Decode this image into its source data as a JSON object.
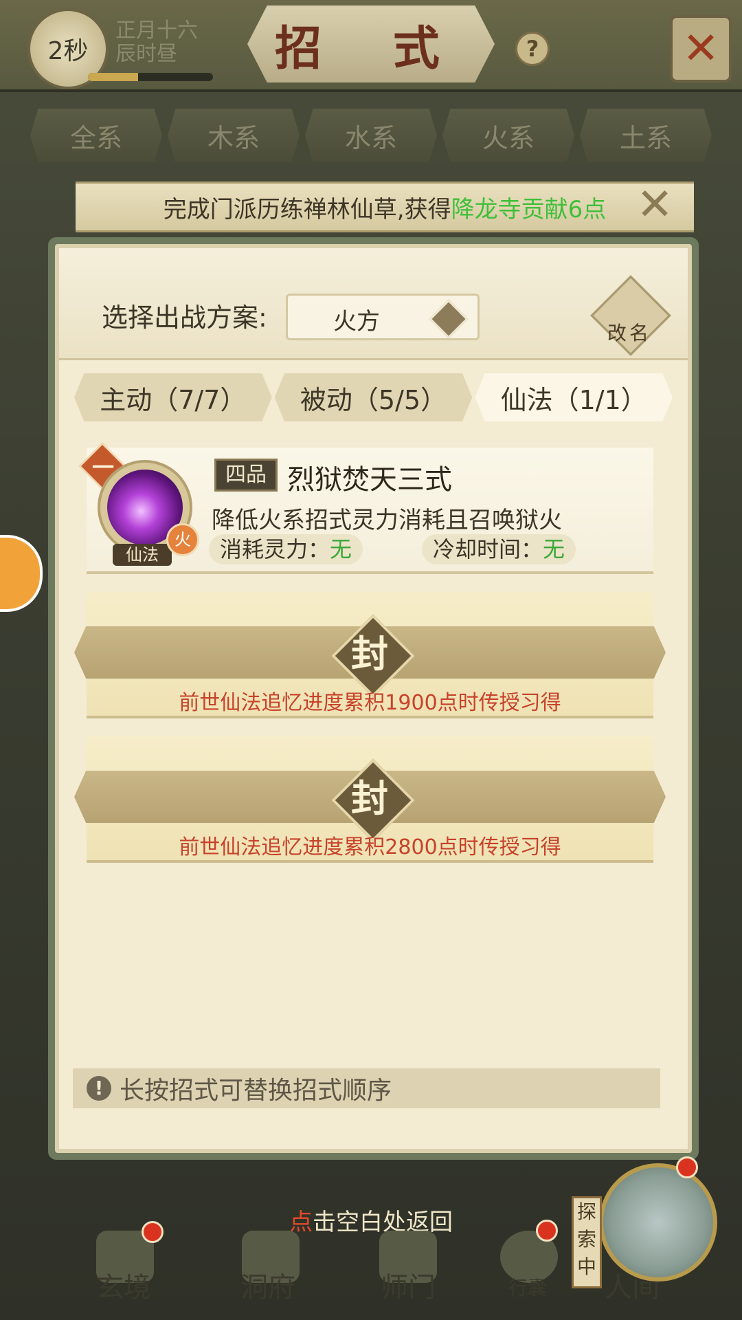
{
  "top_bar": {
    "timer": "2秒",
    "date_line1": "正月十六",
    "date_line2": "辰时昼",
    "title": "招 式",
    "help": "?",
    "close": "✕"
  },
  "element_tabs": [
    "全系",
    "木系",
    "水系",
    "火系",
    "土系"
  ],
  "notice": {
    "text": "完成门派历练禅林仙草,获得",
    "highlight": "降龙寺贡献6点"
  },
  "plan": {
    "label": "选择出战方案:",
    "selected": "火方",
    "rename_label": "改名"
  },
  "type_tabs": [
    {
      "label": "主动（7/7）"
    },
    {
      "label": "被动（5/5）"
    },
    {
      "label": "仙法（1/1）"
    }
  ],
  "skill": {
    "rank": "一",
    "type_label": "仙法",
    "element": "火",
    "grade": "四品",
    "name": "烈狱焚天三式",
    "description": "降低火系招式灵力消耗且召唤狱火",
    "cost_label": "消耗灵力：",
    "cost_value": "无",
    "cooldown_label": "冷却时间：",
    "cooldown_value": "无"
  },
  "sealed_slots": [
    {
      "seal": "封",
      "text": "前世仙法追忆进度累积1900点时传授习得"
    },
    {
      "seal": "封",
      "text": "前世仙法追忆进度累积2800点时传授习得"
    }
  ],
  "hint": "长按招式可替换招式顺序",
  "back_hint": {
    "red": "点",
    "rest": "击空白处返回"
  },
  "bottom_nav": [
    {
      "label": "玄境"
    },
    {
      "label": "洞府"
    },
    {
      "label": "师门"
    },
    {
      "label": "行囊"
    },
    {
      "label": "人间"
    }
  ],
  "explore_tag": "探索中",
  "colors": {
    "highlight_green": "#3fbf3a",
    "seal_text_red": "#c7422a",
    "title_red": "#6c2f1e"
  }
}
